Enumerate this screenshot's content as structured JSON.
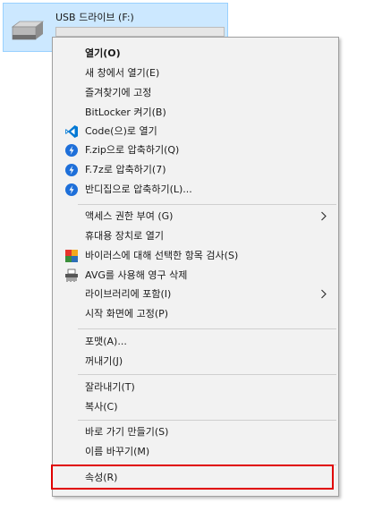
{
  "drive": {
    "title": "USB 드라이브 (F:)",
    "usage_fraction": 0.0,
    "icon": "usb-drive-icon"
  },
  "menu": {
    "items": [
      {
        "label": "열기(O)",
        "bold": true
      },
      {
        "label": "새 창에서 열기(E)"
      },
      {
        "label": "즐겨찾기에 고정"
      },
      {
        "label": "BitLocker 켜기(B)"
      },
      {
        "label": "Code(으)로 열기",
        "icon": "vscode-icon"
      },
      {
        "label": "F.zip으로 압축하기(Q)",
        "icon": "bandizip-icon"
      },
      {
        "label": "F.7z로 압축하기(7)",
        "icon": "bandizip-icon"
      },
      {
        "label": "반디집으로 압축하기(L)...",
        "icon": "bandizip-icon"
      },
      {
        "label": "액세스 권한 부여 (G)",
        "submenu": true
      },
      {
        "label": "휴대용 장치로 열기"
      },
      {
        "label": "바이러스에 대해 선택한 항목 검사(S)",
        "icon": "avg-icon"
      },
      {
        "label": "AVG를 사용해 영구 삭제",
        "icon": "avg-shredder-icon"
      },
      {
        "label": "라이브러리에 포함(I)",
        "submenu": true
      },
      {
        "label": "시작 화면에 고정(P)"
      },
      {
        "label": "포맷(A)..."
      },
      {
        "label": "꺼내기(J)"
      },
      {
        "label": "잘라내기(T)"
      },
      {
        "label": "복사(C)"
      },
      {
        "label": "바로 가기 만들기(S)"
      },
      {
        "label": "이름 바꾸기(M)"
      },
      {
        "label": "속성(R)"
      }
    ]
  },
  "colors": {
    "selection_bg": "#cce8ff",
    "menu_bg": "#f2f2f2",
    "highlight_border": "#e00000",
    "bandizip_blue": "#1e6fd9",
    "vscode_blue": "#0078d4"
  }
}
